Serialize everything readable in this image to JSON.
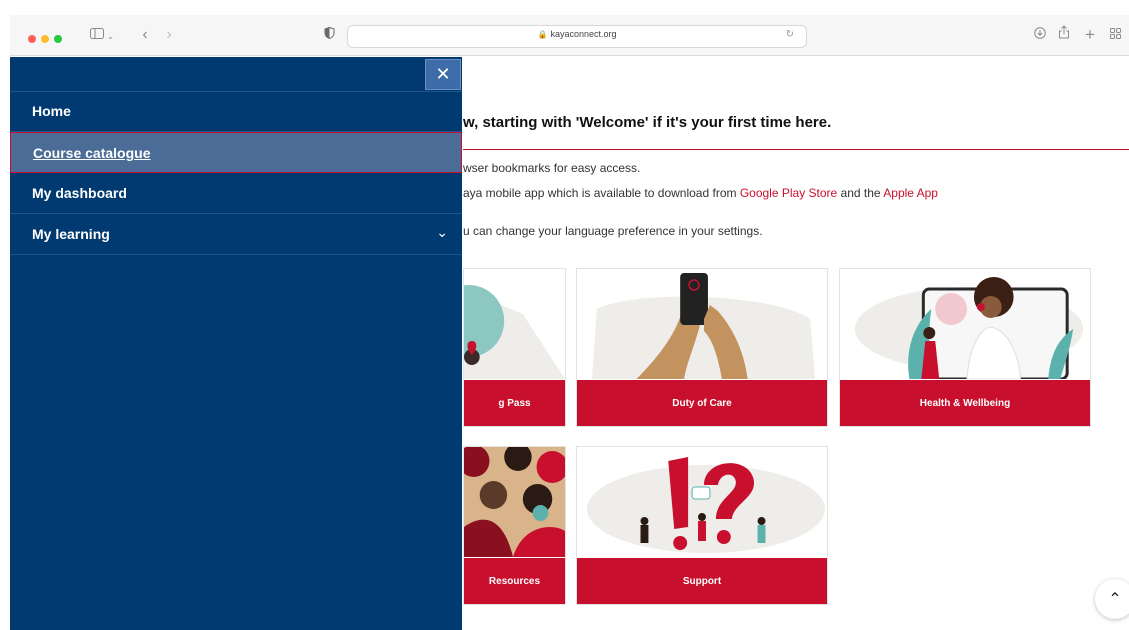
{
  "browser": {
    "url": "kayaconnect.org",
    "icons": [
      "sidebar-icon",
      "back-icon",
      "forward-icon",
      "shield-icon",
      "lock-icon",
      "reload-icon",
      "download-icon",
      "share-icon",
      "new-tab-icon",
      "tab-overview-icon"
    ]
  },
  "drawer": {
    "close_icon": "close-icon",
    "items": [
      {
        "label": "Home"
      },
      {
        "label": "Course catalogue",
        "active": true
      },
      {
        "label": "My dashboard"
      },
      {
        "label": "My learning",
        "has_submenu": true
      }
    ]
  },
  "main": {
    "heading": "w, starting with 'Welcome' if it's your first time here.",
    "para1": "wser bookmarks for easy access.",
    "para2_prefix": "aya mobile app which is available to download from ",
    "link_google": "Google Play Store",
    "para2_mid": " and the ",
    "link_apple": "Apple App",
    "para3": "u can change your language preference in your settings.",
    "cards": [
      {
        "label": "g Pass"
      },
      {
        "label": "Duty of Care"
      },
      {
        "label": "Health & Wellbeing"
      },
      {
        "label": "Resources"
      },
      {
        "label": "Support"
      }
    ]
  },
  "colors": {
    "drawer": "#003a70",
    "accent": "#c8102e",
    "active_item": "#4a6c96"
  }
}
